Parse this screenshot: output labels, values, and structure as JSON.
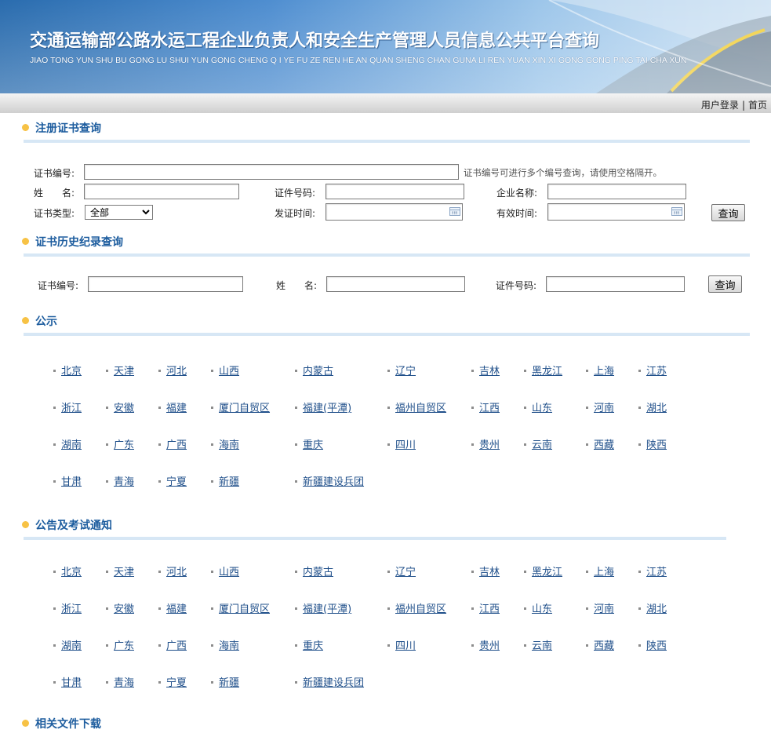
{
  "header": {
    "title": "交通运输部公路水运工程企业负责人和安全生产管理人员信息公共平台查询",
    "subtitle": "JIAO TONG YUN SHU BU GONG LU SHUI YUN GONG CHENG Q I YE FU ZE REN HE AN QUAN SHENG CHAN GUNA LI REN YUAN XIN XI GONG GONG PING TAI CHA XUN"
  },
  "topbar": {
    "login": "用户登录",
    "separator": "|",
    "home": "首页"
  },
  "cert_query": {
    "title": "注册证书查询",
    "cert_no_label": "证书编号:",
    "cert_no_hint": "证书编号可进行多个编号查询，请使用空格隔开。",
    "name_label": "姓　　名:",
    "id_no_label": "证件号码:",
    "company_label": "企业名称:",
    "cert_type_label": "证书类型:",
    "cert_type_value": "全部",
    "issue_date_label": "发证时间:",
    "valid_date_label": "有效时间:",
    "submit": "查询"
  },
  "history_query": {
    "title": "证书历史纪录查询",
    "cert_no_label": "证书编号:",
    "name_label": "姓　　名:",
    "id_no_label": "证件号码:",
    "submit": "查询"
  },
  "notice": {
    "title": "公示",
    "regions": [
      "北京",
      "天津",
      "河北",
      "山西",
      "内蒙古",
      "辽宁",
      "吉林",
      "黑龙江",
      "上海",
      "江苏",
      "浙江",
      "安徽",
      "福建",
      "厦门自贸区",
      "福建(平潭)",
      "福州自贸区",
      "江西",
      "山东",
      "河南",
      "湖北",
      "湖南",
      "广东",
      "广西",
      "海南",
      "重庆",
      "四川",
      "贵州",
      "云南",
      "西藏",
      "陕西",
      "甘肃",
      "青海",
      "宁夏",
      "新疆",
      "新疆建设兵团"
    ]
  },
  "exam_notice": {
    "title": "公告及考试通知",
    "regions": [
      "北京",
      "天津",
      "河北",
      "山西",
      "内蒙古",
      "辽宁",
      "吉林",
      "黑龙江",
      "上海",
      "江苏",
      "浙江",
      "安徽",
      "福建",
      "厦门自贸区",
      "福建(平潭)",
      "福州自贸区",
      "江西",
      "山东",
      "河南",
      "湖北",
      "湖南",
      "广东",
      "广西",
      "海南",
      "重庆",
      "四川",
      "贵州",
      "云南",
      "西藏",
      "陕西",
      "甘肃",
      "青海",
      "宁夏",
      "新疆",
      "新疆建设兵团"
    ]
  },
  "downloads": {
    "title": "相关文件下载"
  },
  "colors": {
    "heading": "#1c5c9e",
    "link": "#1f4f8a",
    "dot": "#f7c245",
    "rule": "#d7e7f5"
  }
}
